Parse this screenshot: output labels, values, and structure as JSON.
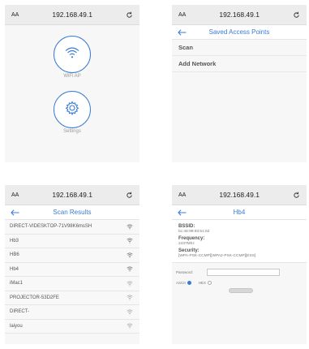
{
  "screens": [
    {
      "url": "192.168.49.1",
      "aa": "AA",
      "buttons": [
        {
          "label": "WiFi AP",
          "icon": "wifi-icon"
        },
        {
          "label": "Settings",
          "icon": "gear-icon"
        }
      ]
    },
    {
      "url": "192.168.49.1",
      "aa": "AA",
      "title": "Saved Access Points",
      "items": [
        "Scan",
        "Add Network"
      ]
    },
    {
      "url": "192.168.49.1",
      "aa": "AA",
      "title": "Scan Results",
      "networks": [
        "DIRECT-VIDESKTOP-71V98K6msSH",
        "Hb3",
        "HB6",
        "Hb4",
        "iMac1",
        "PROJECTOR-53D2FE",
        "DIRECT-",
        "laiyou"
      ]
    },
    {
      "url": "192.168.49.1",
      "aa": "AA",
      "title": "Hb4",
      "bssid_label": "BSSID:",
      "bssid": "bc:46:99:93:51:62",
      "frequency_label": "Frequency:",
      "frequency": "2437Mhz",
      "security_label": "Security:",
      "security": "[WPA-PSK-CCMP][WPA2-PSK-CCMP][ESS]",
      "password_label": "Password:",
      "password_value": "",
      "ascii_label": "ASCII",
      "hex_label": "HEX"
    }
  ],
  "colors": {
    "accent": "#3a7bd5",
    "urlbar": "#ececec",
    "background": "#f7f7f7"
  }
}
